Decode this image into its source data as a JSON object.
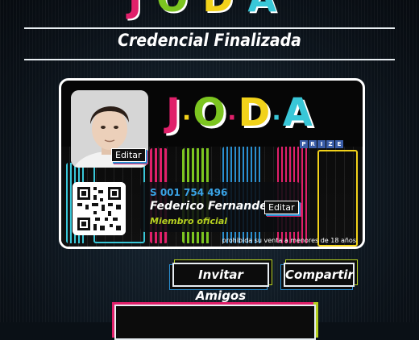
{
  "header": {
    "brand_letters": [
      "J",
      "O",
      "D",
      "A"
    ],
    "title": "Credencial Finalizada"
  },
  "card": {
    "brand_letters": [
      "J",
      "O",
      "D",
      "A"
    ],
    "prize_letters": [
      "P",
      "R",
      "I",
      "Z",
      "E"
    ],
    "photo_edit_label": "Editar",
    "serial": "S 001 754 496",
    "name": "Federico Fernandez",
    "name_edit_label": "Editar",
    "member_status": "Miembro oficial",
    "legal_notice": "prohibida su venta a menores de 18 años"
  },
  "actions": {
    "invite_label": "Invitar Amigos",
    "share_label": "Compartir"
  },
  "colors": {
    "pink": "#e0206a",
    "yellow": "#f2d21a",
    "green": "#7cc520",
    "blue": "#2a8fd0",
    "cyan": "#39c7d8"
  }
}
